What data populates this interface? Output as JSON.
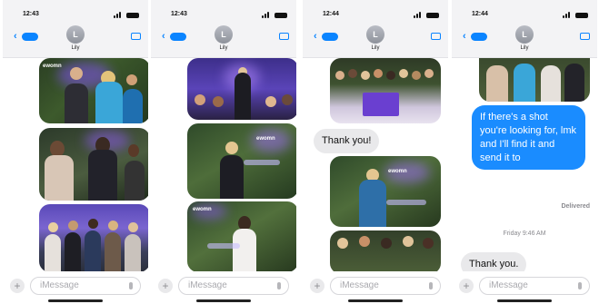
{
  "screens": [
    {
      "time": "12:43",
      "contact": "Lily",
      "avatar_initial": "L",
      "composer_placeholder": "iMessage"
    },
    {
      "time": "12:43",
      "contact": "Lily",
      "avatar_initial": "L",
      "composer_placeholder": "iMessage"
    },
    {
      "time": "12:44",
      "contact": "Lily",
      "avatar_initial": "L",
      "composer_placeholder": "iMessage"
    },
    {
      "time": "12:44",
      "contact": "Lily",
      "avatar_initial": "L",
      "composer_placeholder": "iMessage"
    }
  ],
  "messages": {
    "screen3_incoming": "Thank you!",
    "screen4_outgoing": "If there's a shot you're looking for, lmk and I'll find it and send it to",
    "screen4_status": "Delivered",
    "screen4_timestamp": "Friday 9:46 AM",
    "screen4_incoming": "Thank you."
  },
  "event_sign_text": "ewomn",
  "icons": {
    "back": "chevron-left-icon",
    "video": "video-camera-icon",
    "add": "plus-icon",
    "mic": "microphone-icon"
  },
  "colors": {
    "accent": "#0a84ff",
    "outgoing_bubble": "#1a8cff",
    "incoming_bubble": "#e9e9eb",
    "event_lighting": "#6a3fd0"
  }
}
